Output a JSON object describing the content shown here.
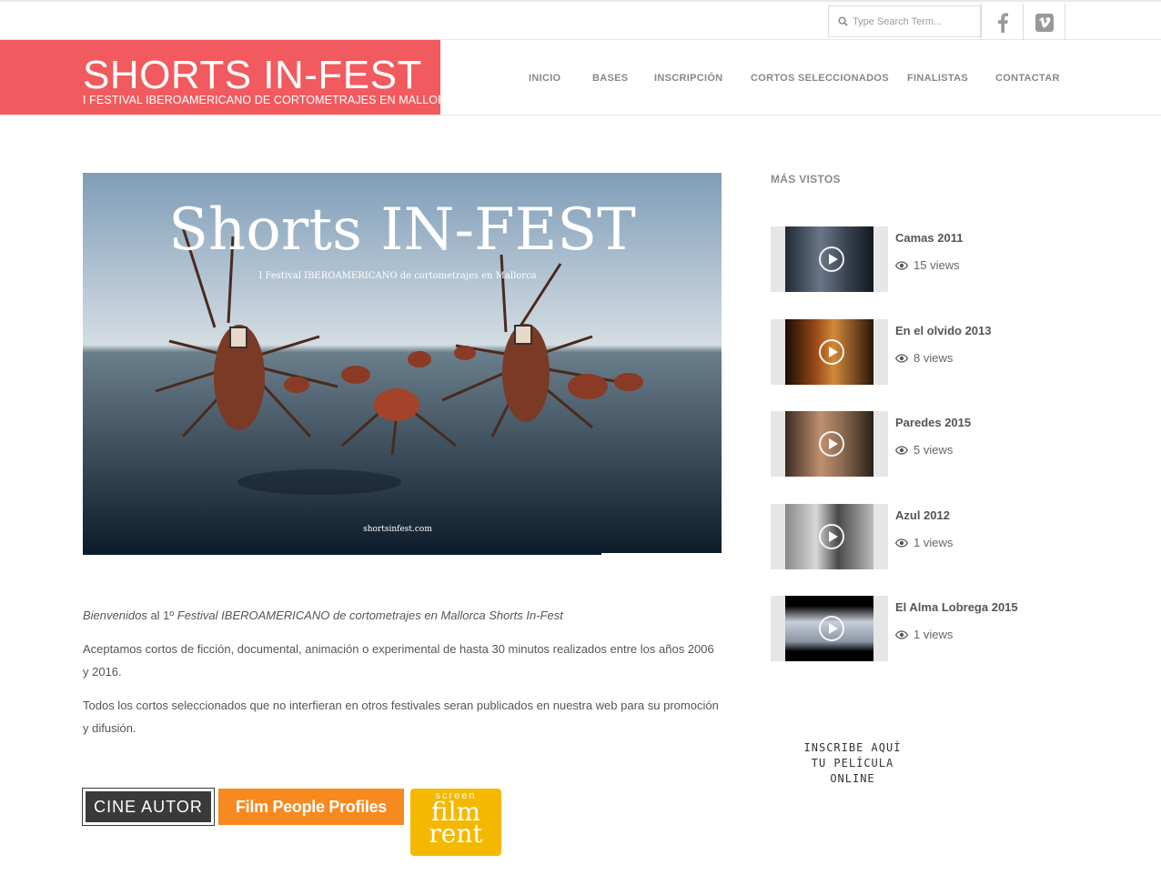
{
  "search": {
    "placeholder": "Type Search Term..."
  },
  "social": {
    "facebook_icon": "facebook-icon",
    "vimeo_icon": "vimeo-icon"
  },
  "brand": {
    "title": "SHORTS IN-FEST",
    "subtitle": "I FESTIVAL IBEROAMERICANO DE CORTOMETRAJES EN MALLORCA",
    "color": "#f15a5e"
  },
  "nav": {
    "items": [
      "INICIO",
      "BASES",
      "INSCRIPCIÓN",
      "CORTOS SELECCIONADOS",
      "FINALISTAS",
      "CONTACTAR"
    ]
  },
  "hero": {
    "title": "Shorts IN-FEST",
    "subtitle": "I Festival IBEROAMERICANO de cortometrajes en Mallorca",
    "url": "shortsinfest.com"
  },
  "intro": {
    "p1_start": "Bienvenidos",
    "p1_mid": " al 1º ",
    "p1_end": "Festival IBEROAMERICANO de cortometrajes en Mallorca Shorts In-Fest",
    "p2": "Aceptamos cortos de ficción, documental, animación o experimental de hasta 30 minutos realizados entre los años 2006 y 2016.",
    "p3": "Todos los cortos seleccionados que no interfieran en otros festivales seran publicados en nuestra web para su promoción y difusión."
  },
  "logos": {
    "cine_autor": "CINE AUTOR",
    "film_people": "Film People Profiles",
    "sfr_top": "screen",
    "sfr_mid": "film",
    "sfr_bot": "rent"
  },
  "sidebar": {
    "title": "MÁS VISTOS",
    "videos": [
      {
        "title": "Camas 2011",
        "views": "15 views"
      },
      {
        "title": "En el olvido 2013",
        "views": "8 views"
      },
      {
        "title": "Paredes 2015",
        "views": "5 views"
      },
      {
        "title": "Azul 2012",
        "views": "1 views"
      },
      {
        "title": "El Alma Lobrega 2015",
        "views": "1 views"
      }
    ],
    "inscribe_line1": "INSCRIBE AQUÍ",
    "inscribe_line2": "TU PELÍCULA ONLINE"
  }
}
